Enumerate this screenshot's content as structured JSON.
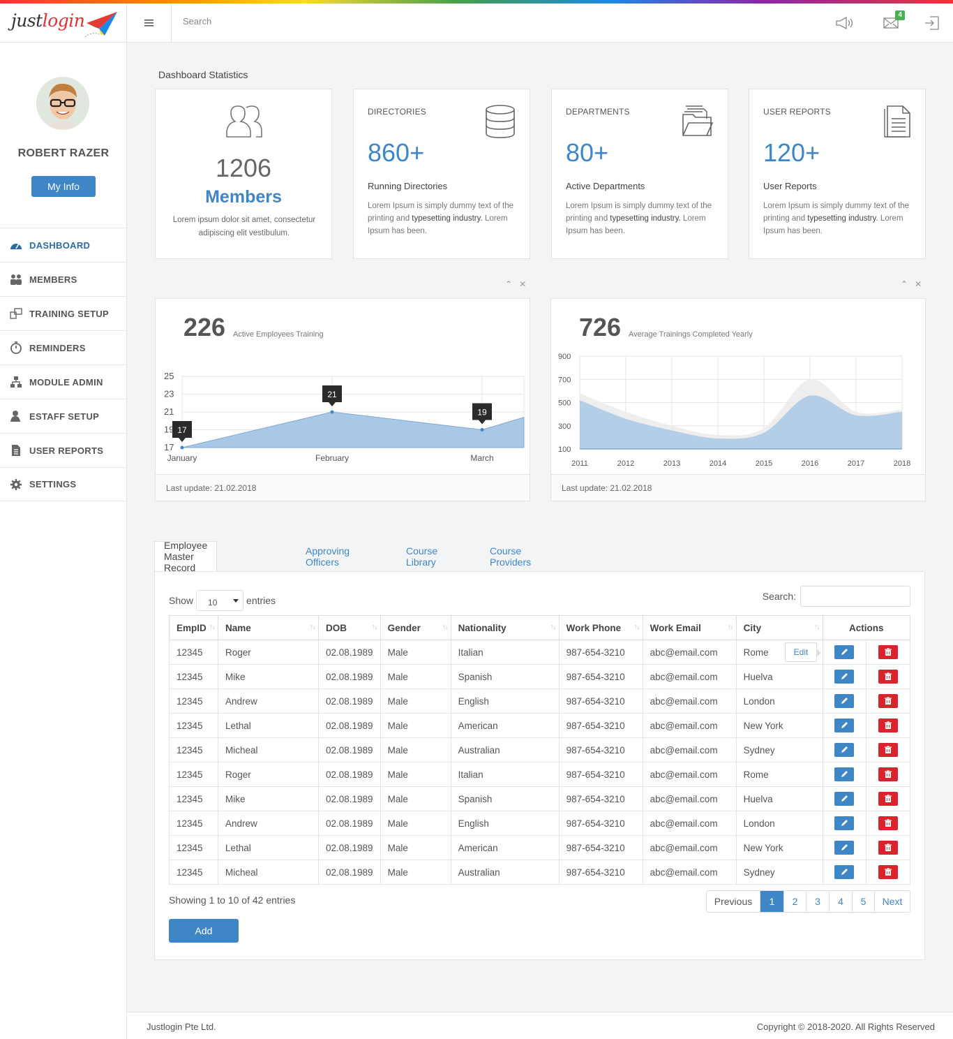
{
  "app": {
    "logo_text_a": "just",
    "logo_text_b": "login",
    "search_placeholder": "Search",
    "mail_badge": "4"
  },
  "user": {
    "name": "ROBERT RAZER",
    "my_info": "My Info"
  },
  "sidebar": {
    "items": [
      {
        "label": "DASHBOARD",
        "icon": "dashboard-gauge-icon"
      },
      {
        "label": "MEMBERS",
        "icon": "members-group-icon"
      },
      {
        "label": "TRAINING SETUP",
        "icon": "training-setup-icon"
      },
      {
        "label": "REMINDERS",
        "icon": "stopwatch-icon"
      },
      {
        "label": "MODULE ADMIN",
        "icon": "sitemap-icon"
      },
      {
        "label": "ESTAFF SETUP",
        "icon": "user-setup-icon"
      },
      {
        "label": "USER REPORTS",
        "icon": "document-icon"
      },
      {
        "label": "SETTINGS",
        "icon": "gear-icon"
      }
    ]
  },
  "dashboard": {
    "title": "Dashboard Statistics",
    "members": {
      "count": "1206",
      "label": "Members",
      "desc": "Lorem ipsum dolor sit amet, consectetur adipiscing elit vestibulum."
    },
    "cards": [
      {
        "title": "DIRECTORIES",
        "value": "860+",
        "sub": "Running Directories",
        "desc_a": "Lorem Ipsum is simply dummy text of the printing and ",
        "desc_b": "typesetting industry.",
        "desc_c": " Lorem Ipsum has been."
      },
      {
        "title": "DEPARTMENTS",
        "value": "80+",
        "sub": "Active Departments",
        "desc_a": "Lorem Ipsum is simply dummy text of the printing and ",
        "desc_b": "typesetting industry.",
        "desc_c": " Lorem Ipsum has been."
      },
      {
        "title": "USER REPORTS",
        "value": "120+",
        "sub": "User Reports",
        "desc_a": "Lorem Ipsum is simply dummy text of the printing and ",
        "desc_b": "typesetting industry.",
        "desc_c": " Lorem Ipsum has been."
      }
    ]
  },
  "chart_data": [
    {
      "type": "area",
      "headline": "226",
      "subtitle": "Active Employees Training",
      "ylim": [
        17,
        25
      ],
      "yticks": [
        "25",
        "23",
        "21",
        "19",
        "17"
      ],
      "x": [
        "January",
        "February",
        "March"
      ],
      "values": [
        17,
        21,
        19,
        20.4
      ],
      "point_labels": [
        "17",
        "21",
        "19"
      ],
      "footer": "Last update: 21.02.2018"
    },
    {
      "type": "area",
      "headline": "726",
      "subtitle": "Average Trainings Completed Yearly",
      "ylim": [
        100,
        900
      ],
      "yticks": [
        "900",
        "700",
        "500",
        "300",
        "100"
      ],
      "x": [
        "2011",
        "2012",
        "2013",
        "2014",
        "2015",
        "2016",
        "2017",
        "2018"
      ],
      "series": [
        {
          "values": [
            580,
            420,
            300,
            220,
            280,
            700,
            420,
            440
          ]
        },
        {
          "values": [
            520,
            360,
            260,
            190,
            240,
            560,
            390,
            420
          ]
        }
      ],
      "footer": "Last update: 21.02.2018"
    }
  ],
  "tabs": [
    "Employee Master Record",
    "Approving Officers",
    "Course Library",
    "Course Providers"
  ],
  "table": {
    "show_label": "Show",
    "entries_value": "10",
    "entries_label": "entries",
    "search_label": "Search:",
    "columns": [
      "EmpID",
      "Name",
      "DOB",
      "Gender",
      "Nationality",
      "Work Phone",
      "Work Email",
      "City",
      "Actions"
    ],
    "rows": [
      [
        "12345",
        "Roger",
        "02.08.1989",
        "Male",
        "Italian",
        "987-654-3210",
        "abc@email.com",
        "Rome"
      ],
      [
        "12345",
        "Mike",
        "02.08.1989",
        "Male",
        "Spanish",
        "987-654-3210",
        "abc@email.com",
        "Huelva"
      ],
      [
        "12345",
        "Andrew",
        "02.08.1989",
        "Male",
        "English",
        "987-654-3210",
        "abc@email.com",
        "London"
      ],
      [
        "12345",
        "Lethal",
        "02.08.1989",
        "Male",
        "American",
        "987-654-3210",
        "abc@email.com",
        "New York"
      ],
      [
        "12345",
        "Micheal",
        "02.08.1989",
        "Male",
        "Australian",
        "987-654-3210",
        "abc@email.com",
        "Sydney"
      ],
      [
        "12345",
        "Roger",
        "02.08.1989",
        "Male",
        "Italian",
        "987-654-3210",
        "abc@email.com",
        "Rome"
      ],
      [
        "12345",
        "Mike",
        "02.08.1989",
        "Male",
        "Spanish",
        "987-654-3210",
        "abc@email.com",
        "Huelva"
      ],
      [
        "12345",
        "Andrew",
        "02.08.1989",
        "Male",
        "English",
        "987-654-3210",
        "abc@email.com",
        "London"
      ],
      [
        "12345",
        "Lethal",
        "02.08.1989",
        "Male",
        "American",
        "987-654-3210",
        "abc@email.com",
        "New York"
      ],
      [
        "12345",
        "Micheal",
        "02.08.1989",
        "Male",
        "Australian",
        "987-654-3210",
        "abc@email.com",
        "Sydney"
      ]
    ],
    "tooltip": "Edit",
    "info": "Showing 1 to 10 of 42 entries",
    "pager": [
      "Previous",
      "1",
      "2",
      "3",
      "4",
      "5",
      "Next"
    ],
    "current_page": "1",
    "add_label": "Add"
  },
  "footer": {
    "left": "Justlogin Pte Ltd.",
    "right": "Copyright © 2018-2020. All Rights Reserved"
  },
  "colors": {
    "primary": "#3f86c7",
    "danger": "#d9232d",
    "badge": "#4caf50",
    "area": "#a9c8e6"
  }
}
